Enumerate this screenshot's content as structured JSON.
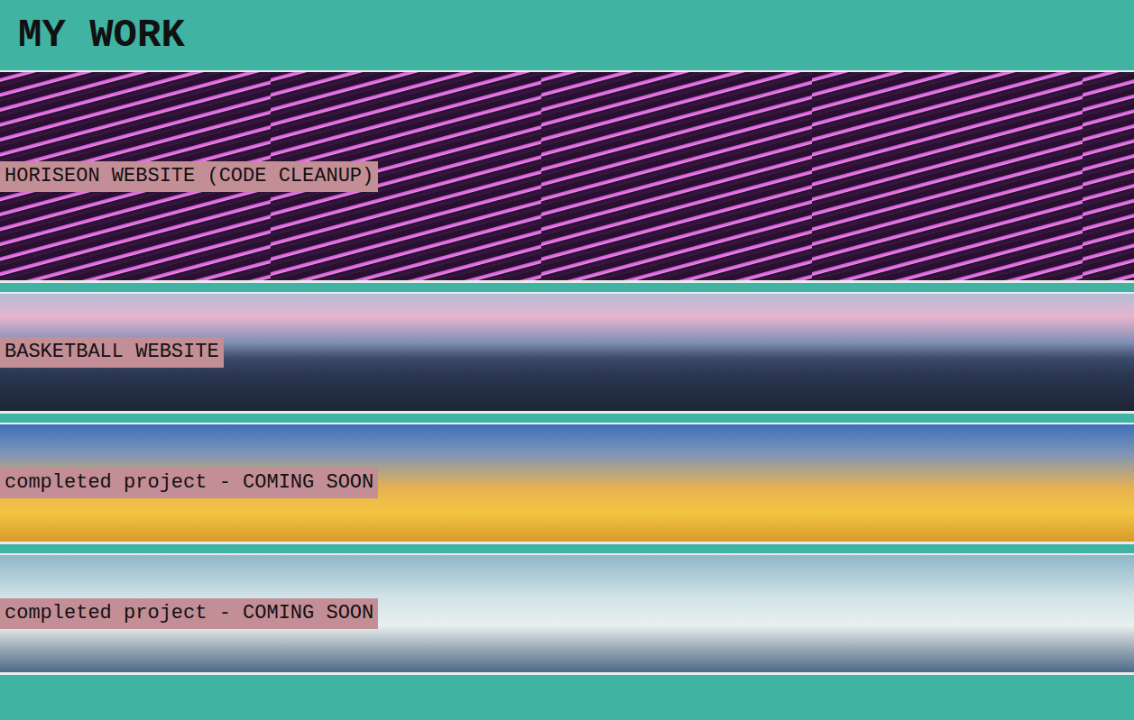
{
  "header": {
    "title": "MY WORK"
  },
  "projects": [
    {
      "label": "HORISEON WEBSITE (CODE CLEANUP)",
      "kind": "code"
    },
    {
      "label": "BASKETBALL WEBSITE",
      "kind": "court"
    },
    {
      "label": "completed project - COMING SOON",
      "kind": "sunset"
    },
    {
      "label": "completed project - COMING SOON",
      "kind": "site"
    }
  ]
}
